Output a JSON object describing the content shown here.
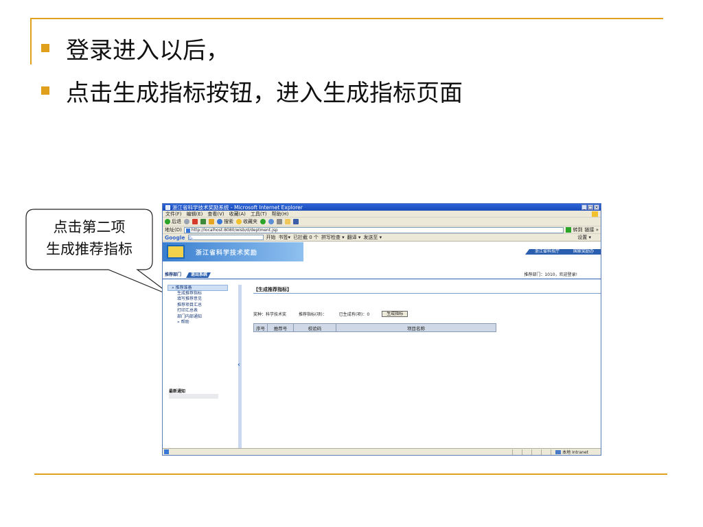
{
  "slide": {
    "bullets": [
      "登录进入以后，",
      "点击生成指标按钮，进入生成指标页面"
    ],
    "callout_lines": [
      "点击第二项",
      "生成推荐指标"
    ],
    "accent_color": "#e0a01c"
  },
  "browser": {
    "window_title": "浙江省科学技术奖励系统 - Microsoft Internet Explorer",
    "menu": [
      "文件(F)",
      "编辑(E)",
      "查看(V)",
      "收藏(A)",
      "工具(T)",
      "帮助(H)"
    ],
    "toolbar": {
      "back": "后退",
      "search": "搜索",
      "favorites": "收藏夹"
    },
    "address_label": "地址(D)",
    "address_value": "http://localhost:8080/wisb/d/deptment.jsp",
    "go_label": "转到",
    "links_label": "链接 »",
    "google": {
      "logo": "Google",
      "g_label": "G-",
      "items": [
        "开始",
        "书签▾",
        "已拦截 0 个",
        "拼写检查 ▾",
        "翻译 ▾",
        "发送至 ▾"
      ],
      "settings": "设置 ▾"
    },
    "status": {
      "zone": "本地 Intranet"
    }
  },
  "app": {
    "banner_title": "浙江省科学技术奖励",
    "right_links": [
      "浙江省科技厅",
      "国家奖励办"
    ],
    "nav_tabs": [
      "推荐部门",
      "退出系统"
    ],
    "user_info": "推荐部门：1010，欢迎登录!",
    "sidebar": {
      "items": [
        {
          "label": "» 推荐准备",
          "type": "hd"
        },
        {
          "label": "生成推荐指标",
          "type": "sub"
        },
        {
          "label": "填写推荐意见",
          "type": "sub"
        },
        {
          "label": "推荐项目汇总",
          "type": "sub"
        },
        {
          "label": "打印汇总表",
          "type": "sub"
        },
        {
          "label": "部门内部通知",
          "type": "sub"
        },
        {
          "label": "» 帮助",
          "type": "sub"
        }
      ],
      "notice_title": "最新通知"
    },
    "main": {
      "title": "【生成推荐指标】",
      "award_type": "奖种：科学技术奖",
      "indicator": "推荐指标(项)：",
      "generated": "已生成有(项)：0",
      "generate_button": "生成指标",
      "columns": [
        "序号",
        "推荐号",
        "校验码",
        "项目名称"
      ]
    }
  }
}
